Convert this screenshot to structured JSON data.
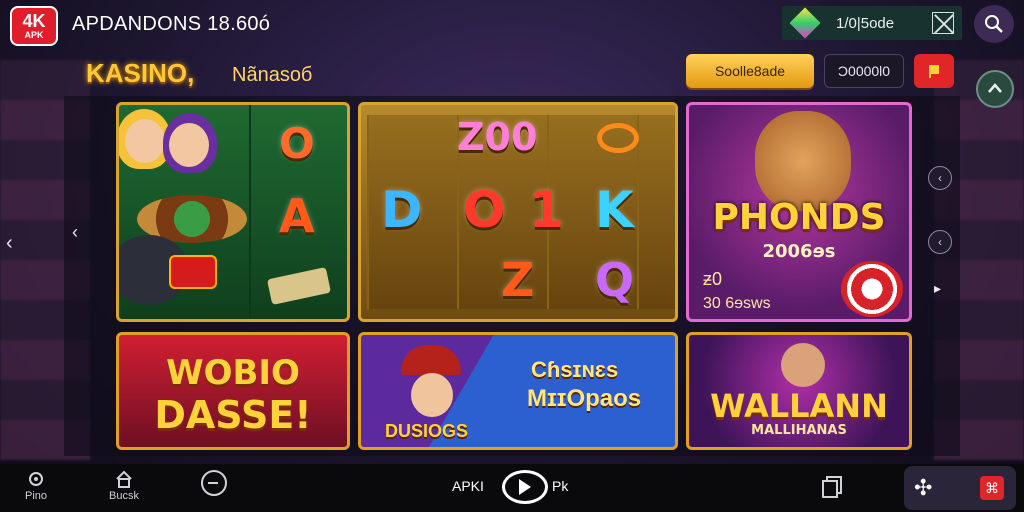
{
  "header": {
    "logo_line1": "4K",
    "logo_line2": "APK",
    "app_title": "APDANDONS 18.60ó",
    "wallet_text": "1/0|5ode",
    "icons": [
      "gem-icon",
      "close-box-icon",
      "search-icon"
    ]
  },
  "hero": {
    "title": "KASINO,",
    "subtitle": "Nãnasoб",
    "gold_button": "Soolle8ade",
    "amount_field": "Ɔ0000l0",
    "red_button_icon": "flag-icon",
    "round_button_icon": "chevron-up-icon"
  },
  "tiles": {
    "slot_left": {
      "symbols": [
        "O",
        "A"
      ]
    },
    "slot_center": {
      "top": "Z00",
      "row": [
        "D",
        "O",
        "1",
        "K"
      ],
      "bottom": [
        "Z",
        "Q"
      ]
    },
    "phonds": {
      "title": "PHONDS",
      "subtitle": "2006ɘs",
      "label1": "ƶ0",
      "label2": "30 6ɘsws"
    },
    "wobio": {
      "line1": "WOBIO",
      "line2": "DASSE!"
    },
    "casinos": {
      "line1": "Cɦsɪɴɛs",
      "line2": "MɪɪOpaos",
      "caption": "DUSIOGS"
    },
    "wallann": {
      "line1": "WALLANN",
      "line2": "MALLIHANAS"
    }
  },
  "bottom_nav": {
    "items": [
      {
        "label": "Pino",
        "icon": "gear-icon"
      },
      {
        "label": "Bucsk",
        "icon": "home-icon"
      },
      {
        "label": "",
        "icon": "clock-icon"
      }
    ],
    "center_left": "APKI",
    "center_right": "Pk",
    "center_icon": "eye-icon",
    "copy_icon": "copy-icon",
    "right_icons": [
      "grid-x-icon",
      "red-app-icon"
    ]
  },
  "colors": {
    "accent_gold": "#ffc838",
    "logo_red": "#e01e2b",
    "wallet_bg": "#17322f"
  }
}
